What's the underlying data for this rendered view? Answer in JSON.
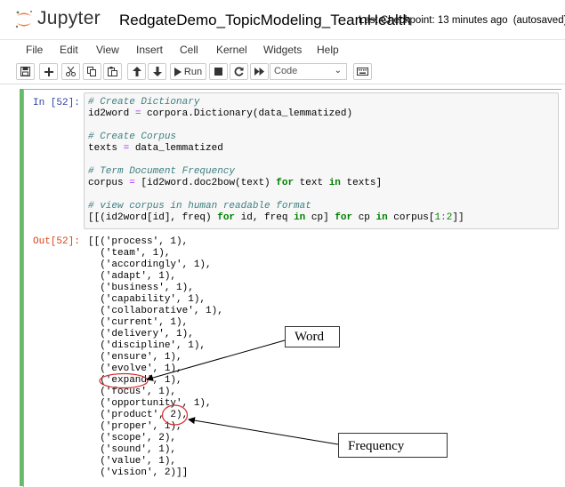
{
  "header": {
    "brand": "Jupyter",
    "notebook_title": "RedgateDemo_TopicModeling_TeamHealth",
    "checkpoint": "Last Checkpoint: 13 minutes ago",
    "autosave": "(autosaved)",
    "logo_icon": "jupyter-logo-icon"
  },
  "menu": {
    "items": [
      "File",
      "Edit",
      "View",
      "Insert",
      "Cell",
      "Kernel",
      "Widgets",
      "Help"
    ]
  },
  "toolbar": {
    "buttons": [
      {
        "name": "save-icon"
      },
      {
        "name": "plus-icon"
      },
      {
        "name": "cut-icon"
      },
      {
        "name": "copy-icon"
      },
      {
        "name": "paste-icon"
      },
      {
        "name": "arrow-up-icon"
      },
      {
        "name": "arrow-down-icon"
      }
    ],
    "run_label": "Run",
    "cell_type": "Code",
    "cell_type_options": [
      "Code"
    ]
  },
  "cell": {
    "in_prompt": "In [52]:",
    "out_prompt": "Out[52]:",
    "code": {
      "c1": "# Create Dictionary",
      "l1a": "id2word ",
      "l1b": "=",
      "l1c": " corpora.Dictionary(data_lemmatized)",
      "c2": "# Create Corpus",
      "l2a": "texts ",
      "l2b": "=",
      "l2c": " data_lemmatized",
      "c3": "# Term Document Frequency",
      "l3a": "corpus ",
      "l3b": "=",
      "l3c": " [id2word.doc2bow(text) ",
      "l3d": "for",
      "l3e": " text ",
      "l3f": "in",
      "l3g": " texts]",
      "c4": "# view corpus in human readable format",
      "l4a": "[[(id2word[id], freq) ",
      "l4b": "for",
      "l4c": " id, freq ",
      "l4d": "in",
      "l4e": " cp] ",
      "l4f": "for",
      "l4g": " cp ",
      "l4h": "in",
      "l4i": " corpus[",
      "l4j": "1",
      "l4k": ":",
      "l4l": "2",
      "l4m": "]]"
    },
    "output_lines": [
      "[[('process', 1),",
      "  ('team', 1),",
      "  ('accordingly', 1),",
      "  ('adapt', 1),",
      "  ('business', 1),",
      "  ('capability', 1),",
      "  ('collaborative', 1),",
      "  ('current', 1),",
      "  ('delivery', 1),",
      "  ('discipline', 1),",
      "  ('ensure', 1),",
      "  ('evolve', 1),",
      "  ('expand', 1),",
      "  ('focus', 1),",
      "  ('opportunity', 1),",
      "  ('product', 2),",
      "  ('proper', 1),",
      "  ('scope', 2),",
      "  ('sound', 1),",
      "  ('value', 1),",
      "  ('vision', 2)]]"
    ]
  },
  "annotations": {
    "word_label": "Word",
    "frequency_label": "Frequency"
  },
  "colors": {
    "selected_cell_bar": "#66bb6a",
    "in_prompt": "#303f9f",
    "out_prompt": "#d84315",
    "annotation_circle": "#d32f2f",
    "jupyter_orange": "#f37726"
  }
}
